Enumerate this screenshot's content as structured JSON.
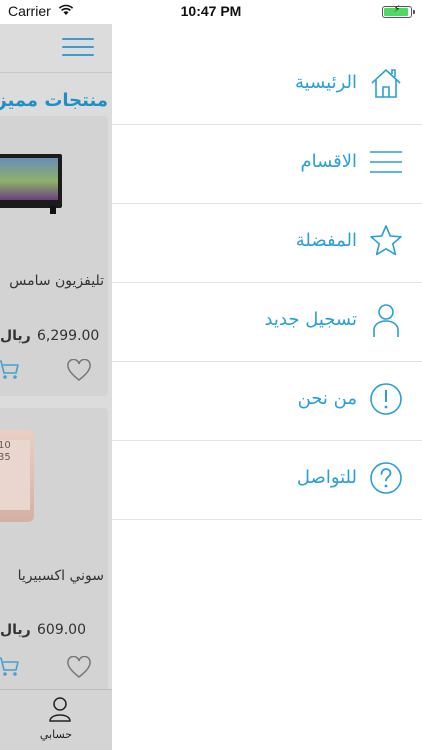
{
  "status_bar": {
    "carrier": "Carrier",
    "time": "10:47 PM"
  },
  "colors": {
    "accent": "#2a9fd6",
    "battery": "#4cd964"
  },
  "underlying": {
    "section_title": "منتجات مميز",
    "products": [
      {
        "name": "تليفزيون سامس",
        "price": "6,299.00",
        "currency": "ريال"
      },
      {
        "name": "سوني اكسبيريا",
        "price": "609.00",
        "currency": "ريال"
      }
    ],
    "phone_screen_text": [
      "10",
      "35"
    ],
    "tab_bar": {
      "account_label": "حسابي"
    }
  },
  "menu": {
    "items": [
      {
        "label": "الرئيسية",
        "icon": "home-icon"
      },
      {
        "label": "الاقسام",
        "icon": "list-icon"
      },
      {
        "label": "المفضلة",
        "icon": "star-icon"
      },
      {
        "label": "تسجيل جديد",
        "icon": "user-icon"
      },
      {
        "label": "من نحن",
        "icon": "info-icon"
      },
      {
        "label": "للتواصل",
        "icon": "help-icon"
      }
    ]
  }
}
